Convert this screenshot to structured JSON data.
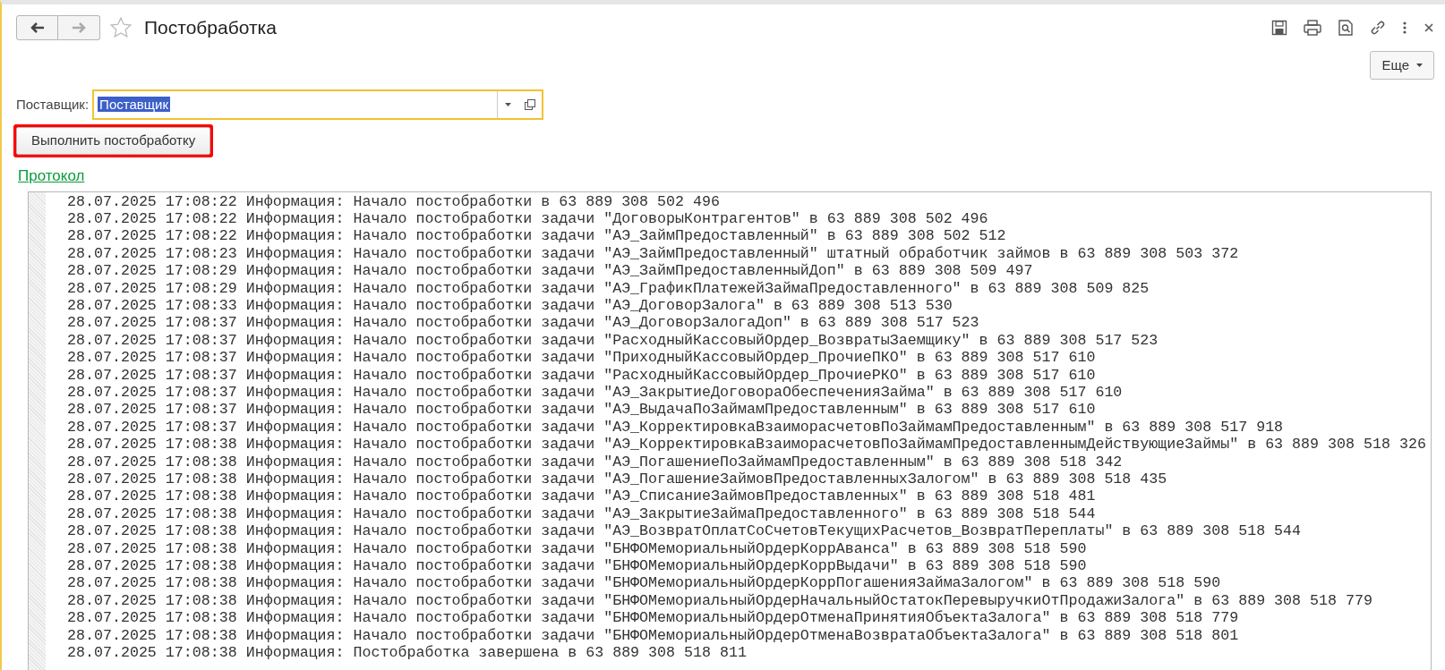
{
  "window": {
    "title": "Постобработка"
  },
  "more_button": {
    "label": "Еще"
  },
  "supplier": {
    "label": "Поставщик:",
    "value": "Поставщик",
    "value_selected": true
  },
  "run_button": {
    "label": "Выполнить постобработку",
    "highlighted": true
  },
  "protocol_link": "Протокол",
  "log": [
    "28.07.2025 17:08:22 Информация: Начало постобработки в 63 889 308 502 496",
    "28.07.2025 17:08:22 Информация: Начало постобработки задачи \"ДоговорыКонтрагентов\" в 63 889 308 502 496",
    "28.07.2025 17:08:22 Информация: Начало постобработки задачи \"АЭ_ЗаймПредоставленный\" в 63 889 308 502 512",
    "28.07.2025 17:08:23 Информация: Начало постобработки задачи \"АЭ_ЗаймПредоставленный\" штатный обработчик займов в 63 889 308 503 372",
    "28.07.2025 17:08:29 Информация: Начало постобработки задачи \"АЭ_ЗаймПредоставленныйДоп\" в 63 889 308 509 497",
    "28.07.2025 17:08:29 Информация: Начало постобработки задачи \"АЭ_ГрафикПлатежейЗаймаПредоставленного\" в 63 889 308 509 825",
    "28.07.2025 17:08:33 Информация: Начало постобработки задачи \"АЭ_ДоговорЗалога\" в 63 889 308 513 530",
    "28.07.2025 17:08:37 Информация: Начало постобработки задачи \"АЭ_ДоговорЗалогаДоп\" в 63 889 308 517 523",
    "28.07.2025 17:08:37 Информация: Начало постобработки задачи \"РасходныйКассовыйОрдер_ВозвратыЗаемщику\" в 63 889 308 517 523",
    "28.07.2025 17:08:37 Информация: Начало постобработки задачи \"ПриходныйКассовыйОрдер_ПрочиеПКО\" в 63 889 308 517 610",
    "28.07.2025 17:08:37 Информация: Начало постобработки задачи \"РасходныйКассовыйОрдер_ПрочиеРКО\" в 63 889 308 517 610",
    "28.07.2025 17:08:37 Информация: Начало постобработки задачи \"АЭ_ЗакрытиеДоговораОбеспеченияЗайма\" в 63 889 308 517 610",
    "28.07.2025 17:08:37 Информация: Начало постобработки задачи \"АЭ_ВыдачаПоЗаймамПредоставленным\" в 63 889 308 517 610",
    "28.07.2025 17:08:37 Информация: Начало постобработки задачи \"АЭ_КорректировкаВзаиморасчетовПоЗаймамПредоставленным\" в 63 889 308 517 918",
    "28.07.2025 17:08:38 Информация: Начало постобработки задачи \"АЭ_КорректировкаВзаиморасчетовПоЗаймамПредоставленнымДействующиеЗаймы\" в 63 889 308 518 326",
    "28.07.2025 17:08:38 Информация: Начало постобработки задачи \"АЭ_ПогашениеПоЗаймамПредоставленным\" в 63 889 308 518 342",
    "28.07.2025 17:08:38 Информация: Начало постобработки задачи \"АЭ_ПогашениеЗаймовПредоставленныхЗалогом\" в 63 889 308 518 435",
    "28.07.2025 17:08:38 Информация: Начало постобработки задачи \"АЭ_СписаниеЗаймовПредоставленных\" в 63 889 308 518 481",
    "28.07.2025 17:08:38 Информация: Начало постобработки задачи \"АЭ_ЗакрытиеЗаймаПредоставленного\" в 63 889 308 518 544",
    "28.07.2025 17:08:38 Информация: Начало постобработки задачи \"АЭ_ВозвратОплатСоСчетовТекущихРасчетов_ВозвратПереплаты\" в 63 889 308 518 544",
    "28.07.2025 17:08:38 Информация: Начало постобработки задачи \"БНФОМемориальныйОрдерКоррАванса\" в 63 889 308 518 590",
    "28.07.2025 17:08:38 Информация: Начало постобработки задачи \"БНФОМемориальныйОрдерКоррВыдачи\" в 63 889 308 518 590",
    "28.07.2025 17:08:38 Информация: Начало постобработки задачи \"БНФОМемориальныйОрдерКоррПогашенияЗаймаЗалогом\" в 63 889 308 518 590",
    "28.07.2025 17:08:38 Информация: Начало постобработки задачи \"БНФОМемориальныйОрдерНачальныйОстатокПеревыручкиОтПродажиЗалога\" в 63 889 308 518 779",
    "28.07.2025 17:08:38 Информация: Начало постобработки задачи \"БНФОМемориальныйОрдерОтменаПринятияОбъектаЗалога\" в 63 889 308 518 779",
    "28.07.2025 17:08:38 Информация: Начало постобработки задачи \"БНФОМемориальныйОрдерОтменаВозвратаОбъектаЗалога\" в 63 889 308 518 801",
    "28.07.2025 17:08:38 Информация: Постобработка завершена в 63 889 308 518 811"
  ]
}
